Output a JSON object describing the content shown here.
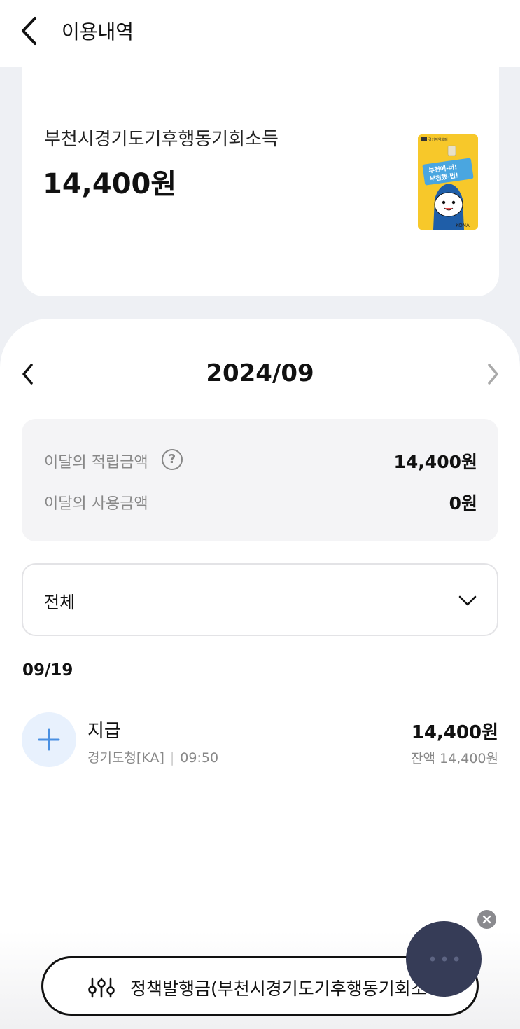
{
  "header": {
    "title": "이용내역"
  },
  "summary": {
    "card_name": "부천시경기도기후행동기회소득",
    "balance": "14,400원",
    "card_art": {
      "brand_text": "경기지역화폐",
      "slogan_line1": "부천에-버!",
      "slogan_line2": "부천했-법!",
      "maker_text": "KONA"
    }
  },
  "month_nav": {
    "label": "2024/09"
  },
  "stats": {
    "earned_label": "이달의 적립금액",
    "earned_value": "14,400원",
    "used_label": "이달의 사용금액",
    "used_value": "0원",
    "help_icon_glyph": "?"
  },
  "filter": {
    "selected": "전체"
  },
  "transactions": {
    "date": "09/19",
    "items": [
      {
        "title": "지급",
        "source": "경기도청[KA]",
        "separator": "|",
        "time": "09:50",
        "amount": "14,400원",
        "balance": "잔액 14,400원",
        "icon": "plus-icon"
      }
    ]
  },
  "policy_bar": {
    "label": "정책발행금(부천시경기도기후행동기회소득)",
    "icon": "sliders-icon"
  },
  "colors": {
    "accent_blue": "#4a90e2",
    "fab_bg": "#363c57",
    "card_yellow": "#f7c82a"
  }
}
